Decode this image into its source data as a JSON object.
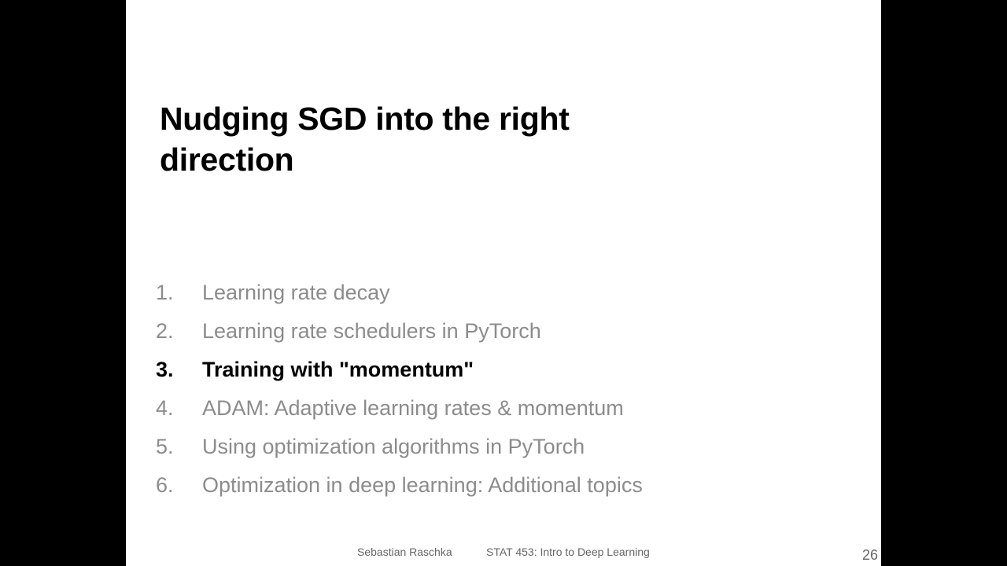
{
  "slide": {
    "title_lines": [
      "Nudging SGD into the right",
      "direction"
    ],
    "agenda": [
      {
        "number": "1.",
        "text": "Learning rate decay",
        "active": false
      },
      {
        "number": "2.",
        "text": "Learning rate schedulers in PyTorch",
        "active": false
      },
      {
        "number": "3.",
        "text": "Training with \"momentum\"",
        "active": true
      },
      {
        "number": "4.",
        "text": "ADAM: Adaptive learning rates & momentum",
        "active": false
      },
      {
        "number": "5.",
        "text": "Using optimization algorithms in PyTorch",
        "active": false
      },
      {
        "number": "6.",
        "text": "Optimization in deep learning: Additional topics",
        "active": false
      }
    ],
    "footer": {
      "author": "Sebastian Raschka",
      "course": "STAT 453: Intro to Deep Learning"
    },
    "page_number": "26"
  },
  "colors": {
    "background": "#000000",
    "slide": "#ffffff",
    "title": "#000000",
    "agenda_inactive": "#8c8c8c",
    "agenda_active": "#000000",
    "footer": "#666666"
  }
}
